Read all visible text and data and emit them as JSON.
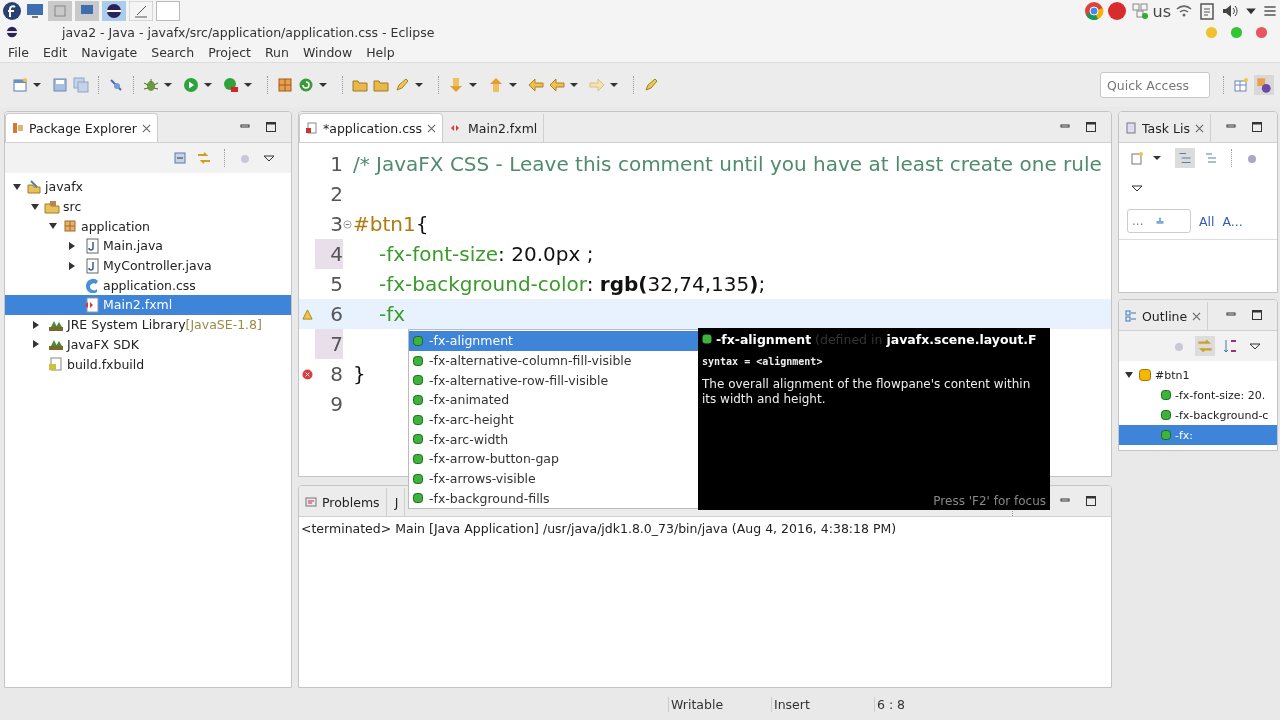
{
  "system_bar": {
    "keyboard": "us"
  },
  "window": {
    "title": "java2 - Java - javafx/src/application/application.css - Eclipse"
  },
  "menu": [
    "File",
    "Edit",
    "Navigate",
    "Search",
    "Project",
    "Run",
    "Window",
    "Help"
  ],
  "quick_access": {
    "placeholder": "Quick Access"
  },
  "package_explorer": {
    "tab": {
      "label": "Package Explorer"
    },
    "tree": [
      {
        "label": "javafx",
        "kind": "project",
        "expanded": true,
        "selected": false,
        "children": [
          {
            "label": "src",
            "kind": "source",
            "expanded": true,
            "selected": false,
            "children": [
              {
                "label": "application",
                "kind": "package",
                "expanded": true,
                "selected": false,
                "children": [
                  {
                    "label": "Main.java",
                    "kind": "java",
                    "expanded": false,
                    "selected": false
                  },
                  {
                    "label": "MyController.java",
                    "kind": "java",
                    "expanded": false,
                    "selected": false
                  },
                  {
                    "label": "application.css",
                    "kind": "css",
                    "selected": false
                  },
                  {
                    "label": "Main2.fxml",
                    "kind": "fxml",
                    "selected": true
                  }
                ]
              }
            ]
          },
          {
            "label": "JRE System Library",
            "note": "[JavaSE-1.8]",
            "kind": "library",
            "expanded": false,
            "selected": false
          },
          {
            "label": "JavaFX SDK",
            "kind": "library",
            "expanded": false,
            "selected": false
          },
          {
            "label": "build.fxbuild",
            "kind": "build",
            "selected": false
          }
        ]
      }
    ]
  },
  "editor": {
    "tabs": [
      {
        "label": "*application.css",
        "kind": "css",
        "selected": true
      },
      {
        "label": "Main2.fxml",
        "kind": "fxml",
        "selected": false
      }
    ],
    "lines": [
      {
        "number": "1",
        "foldable": false,
        "warning": false,
        "error": false,
        "changed": false,
        "current": false,
        "segments": [
          {
            "kind": "comment",
            "text": "/* JavaFX CSS - Leave this comment until you have at least create one rule"
          }
        ]
      },
      {
        "number": "2",
        "foldable": false,
        "warning": false,
        "error": false,
        "changed": false,
        "current": false
      },
      {
        "number": "3",
        "foldable": true,
        "warning": false,
        "error": false,
        "changed": false,
        "current": false,
        "segments": [
          {
            "kind": "selector",
            "text": "#btn1"
          },
          {
            "kind": "plain",
            "text": "{"
          }
        ]
      },
      {
        "number": "4",
        "foldable": false,
        "warning": false,
        "error": false,
        "changed": true,
        "current": false,
        "segments": [
          {
            "kind": "property",
            "text": "-fx-font-size"
          },
          {
            "kind": "plain",
            "text": ": 20.0px ;"
          }
        ]
      },
      {
        "number": "5",
        "foldable": false,
        "warning": false,
        "error": false,
        "changed": false,
        "current": false,
        "segments": [
          {
            "kind": "property",
            "text": "-fx-background-color"
          },
          {
            "kind": "plain",
            "text": ": "
          },
          {
            "kind": "bold",
            "text": "rgb("
          },
          {
            "kind": "plain",
            "text": "32,74,135"
          },
          {
            "kind": "bold",
            "text": ")"
          },
          {
            "kind": "plain",
            "text": ";"
          }
        ]
      },
      {
        "number": "6",
        "foldable": false,
        "warning": true,
        "error": false,
        "changed": false,
        "current": true,
        "segments": [
          {
            "kind": "property",
            "text": "-fx"
          }
        ]
      },
      {
        "number": "7",
        "foldable": false,
        "warning": false,
        "error": false,
        "changed": true,
        "current": false
      },
      {
        "number": "8",
        "foldable": false,
        "warning": false,
        "error": true,
        "changed": false,
        "current": false,
        "segments": [
          {
            "kind": "plain",
            "text": "}"
          }
        ]
      },
      {
        "number": "9",
        "foldable": false,
        "warning": false,
        "error": false,
        "changed": false,
        "current": false
      }
    ]
  },
  "completion": {
    "items": [
      {
        "label": "-fx-alignment",
        "selected": true
      },
      {
        "label": "-fx-alternative-column-fill-visible",
        "selected": false
      },
      {
        "label": "-fx-alternative-row-fill-visible",
        "selected": false
      },
      {
        "label": "-fx-animated",
        "selected": false
      },
      {
        "label": "-fx-arc-height",
        "selected": false
      },
      {
        "label": "-fx-arc-width",
        "selected": false
      },
      {
        "label": "-fx-arrow-button-gap",
        "selected": false
      },
      {
        "label": "-fx-arrows-visible",
        "selected": false
      },
      {
        "label": "-fx-background-fills",
        "selected": false
      }
    ]
  },
  "doc": {
    "name": "-fx-alignment",
    "defined": "(defined in",
    "class": "javafx.scene.layout.F",
    "syntax": "syntax = <alignment>",
    "description": "The overall alignment of the flowpane's content within its width and height.",
    "footer": "Press 'F2' for focus"
  },
  "task_list": {
    "tab": {
      "label": "Task Lis"
    },
    "filter": {
      "value": "..."
    },
    "links": [
      "All",
      "A..."
    ]
  },
  "outline": {
    "tab": {
      "label": "Outline"
    },
    "tree": [
      {
        "label": "#btn1",
        "kind": "rule",
        "expanded": true,
        "selected": false,
        "children": [
          {
            "label": "-fx-font-size: 20.",
            "kind": "property",
            "selected": false
          },
          {
            "label": "-fx-background-c",
            "kind": "property",
            "selected": false
          },
          {
            "label": "-fx:",
            "kind": "property",
            "selected": true
          }
        ]
      }
    ]
  },
  "bottom": {
    "tabs": [
      {
        "label": "Problems"
      },
      {
        "label": "J"
      }
    ],
    "console": "<terminated> Main [Java Application] /usr/java/jdk1.8.0_73/bin/java (Aug 4, 2016, 4:38:18 PM)"
  },
  "status_bar": [
    "Writable",
    "Insert",
    "6 : 8"
  ]
}
